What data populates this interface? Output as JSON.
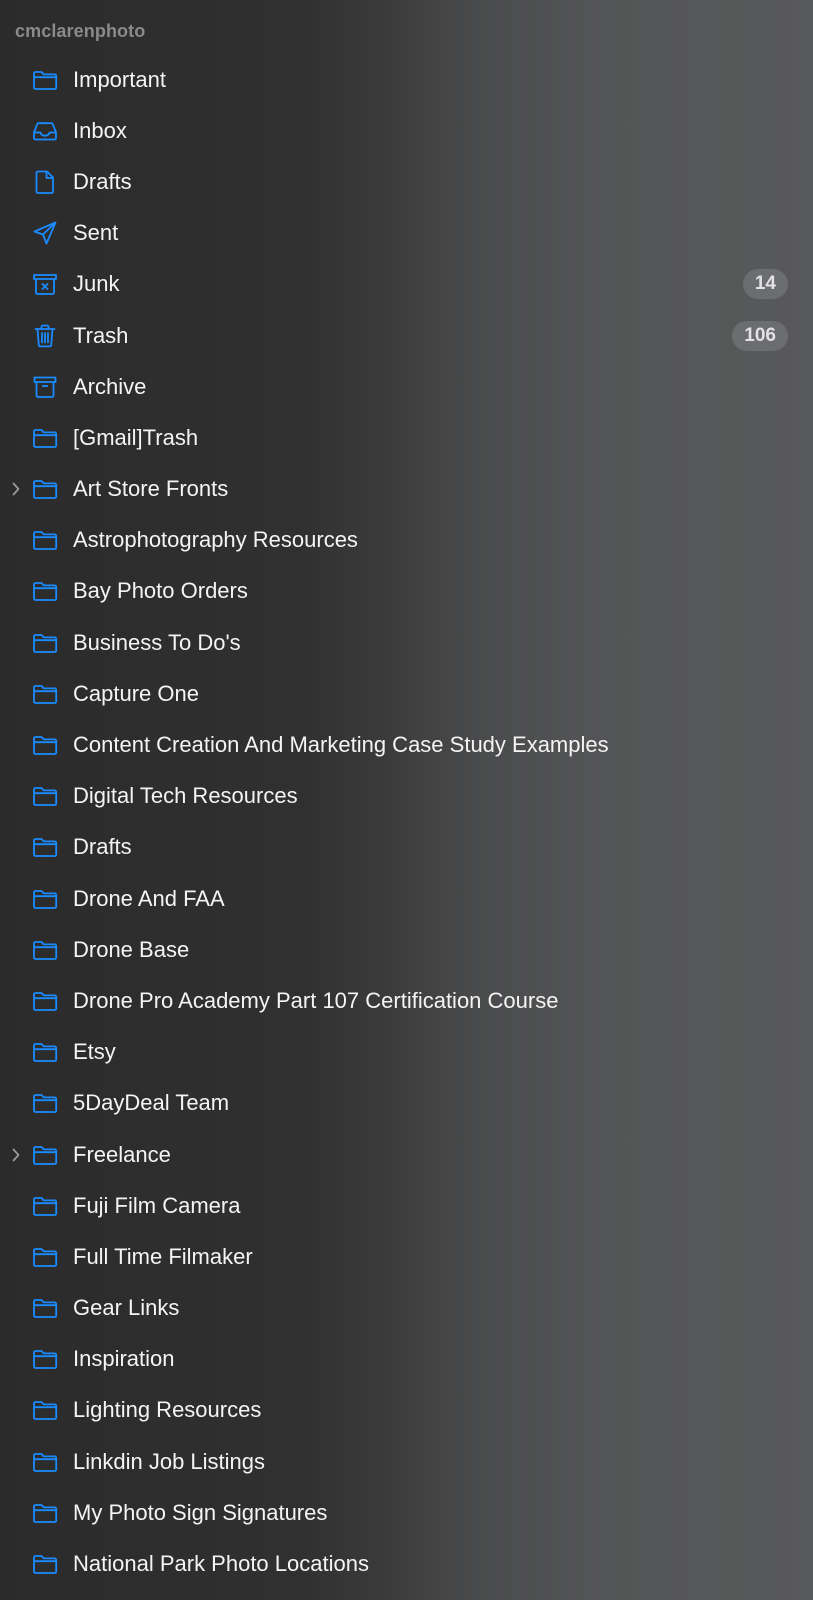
{
  "account": {
    "name": "cmclarenphoto"
  },
  "accent_color": "#1a8cff",
  "mailboxes": [
    {
      "label": "Important",
      "icon": "folder-icon",
      "expandable": false,
      "badge": null
    },
    {
      "label": "Inbox",
      "icon": "inbox-tray-icon",
      "expandable": false,
      "badge": null
    },
    {
      "label": "Drafts",
      "icon": "document-icon",
      "expandable": false,
      "badge": null
    },
    {
      "label": "Sent",
      "icon": "paper-plane-icon",
      "expandable": false,
      "badge": null
    },
    {
      "label": "Junk",
      "icon": "junk-box-icon",
      "expandable": false,
      "badge": "14"
    },
    {
      "label": "Trash",
      "icon": "trash-icon",
      "expandable": false,
      "badge": "106"
    },
    {
      "label": "Archive",
      "icon": "archive-box-icon",
      "expandable": false,
      "badge": null
    },
    {
      "label": "[Gmail]Trash",
      "icon": "folder-icon",
      "expandable": false,
      "badge": null
    },
    {
      "label": "Art Store Fronts",
      "icon": "folder-icon",
      "expandable": true,
      "badge": null
    },
    {
      "label": "Astrophotography Resources",
      "icon": "folder-icon",
      "expandable": false,
      "badge": null
    },
    {
      "label": "Bay Photo Orders",
      "icon": "folder-icon",
      "expandable": false,
      "badge": null
    },
    {
      "label": "Business To Do's",
      "icon": "folder-icon",
      "expandable": false,
      "badge": null
    },
    {
      "label": "Capture One",
      "icon": "folder-icon",
      "expandable": false,
      "badge": null
    },
    {
      "label": "Content Creation And Marketing Case Study Examples",
      "icon": "folder-icon",
      "expandable": false,
      "badge": null
    },
    {
      "label": "Digital Tech Resources",
      "icon": "folder-icon",
      "expandable": false,
      "badge": null
    },
    {
      "label": "Drafts",
      "icon": "folder-icon",
      "expandable": false,
      "badge": null
    },
    {
      "label": "Drone And FAA",
      "icon": "folder-icon",
      "expandable": false,
      "badge": null
    },
    {
      "label": "Drone Base",
      "icon": "folder-icon",
      "expandable": false,
      "badge": null
    },
    {
      "label": "Drone Pro Academy Part 107 Certification Course",
      "icon": "folder-icon",
      "expandable": false,
      "badge": null
    },
    {
      "label": "Etsy",
      "icon": "folder-icon",
      "expandable": false,
      "badge": null
    },
    {
      "label": "5DayDeal Team",
      "icon": "folder-icon",
      "expandable": false,
      "badge": null
    },
    {
      "label": "Freelance",
      "icon": "folder-icon",
      "expandable": true,
      "badge": null
    },
    {
      "label": "Fuji Film Camera",
      "icon": "folder-icon",
      "expandable": false,
      "badge": null
    },
    {
      "label": "Full Time Filmaker",
      "icon": "folder-icon",
      "expandable": false,
      "badge": null
    },
    {
      "label": "Gear Links",
      "icon": "folder-icon",
      "expandable": false,
      "badge": null
    },
    {
      "label": "Inspiration",
      "icon": "folder-icon",
      "expandable": false,
      "badge": null
    },
    {
      "label": "Lighting Resources",
      "icon": "folder-icon",
      "expandable": false,
      "badge": null
    },
    {
      "label": "Linkdin Job Listings",
      "icon": "folder-icon",
      "expandable": false,
      "badge": null
    },
    {
      "label": "My Photo Sign Signatures",
      "icon": "folder-icon",
      "expandable": false,
      "badge": null
    },
    {
      "label": "National Park Photo Locations",
      "icon": "folder-icon",
      "expandable": false,
      "badge": null
    }
  ]
}
